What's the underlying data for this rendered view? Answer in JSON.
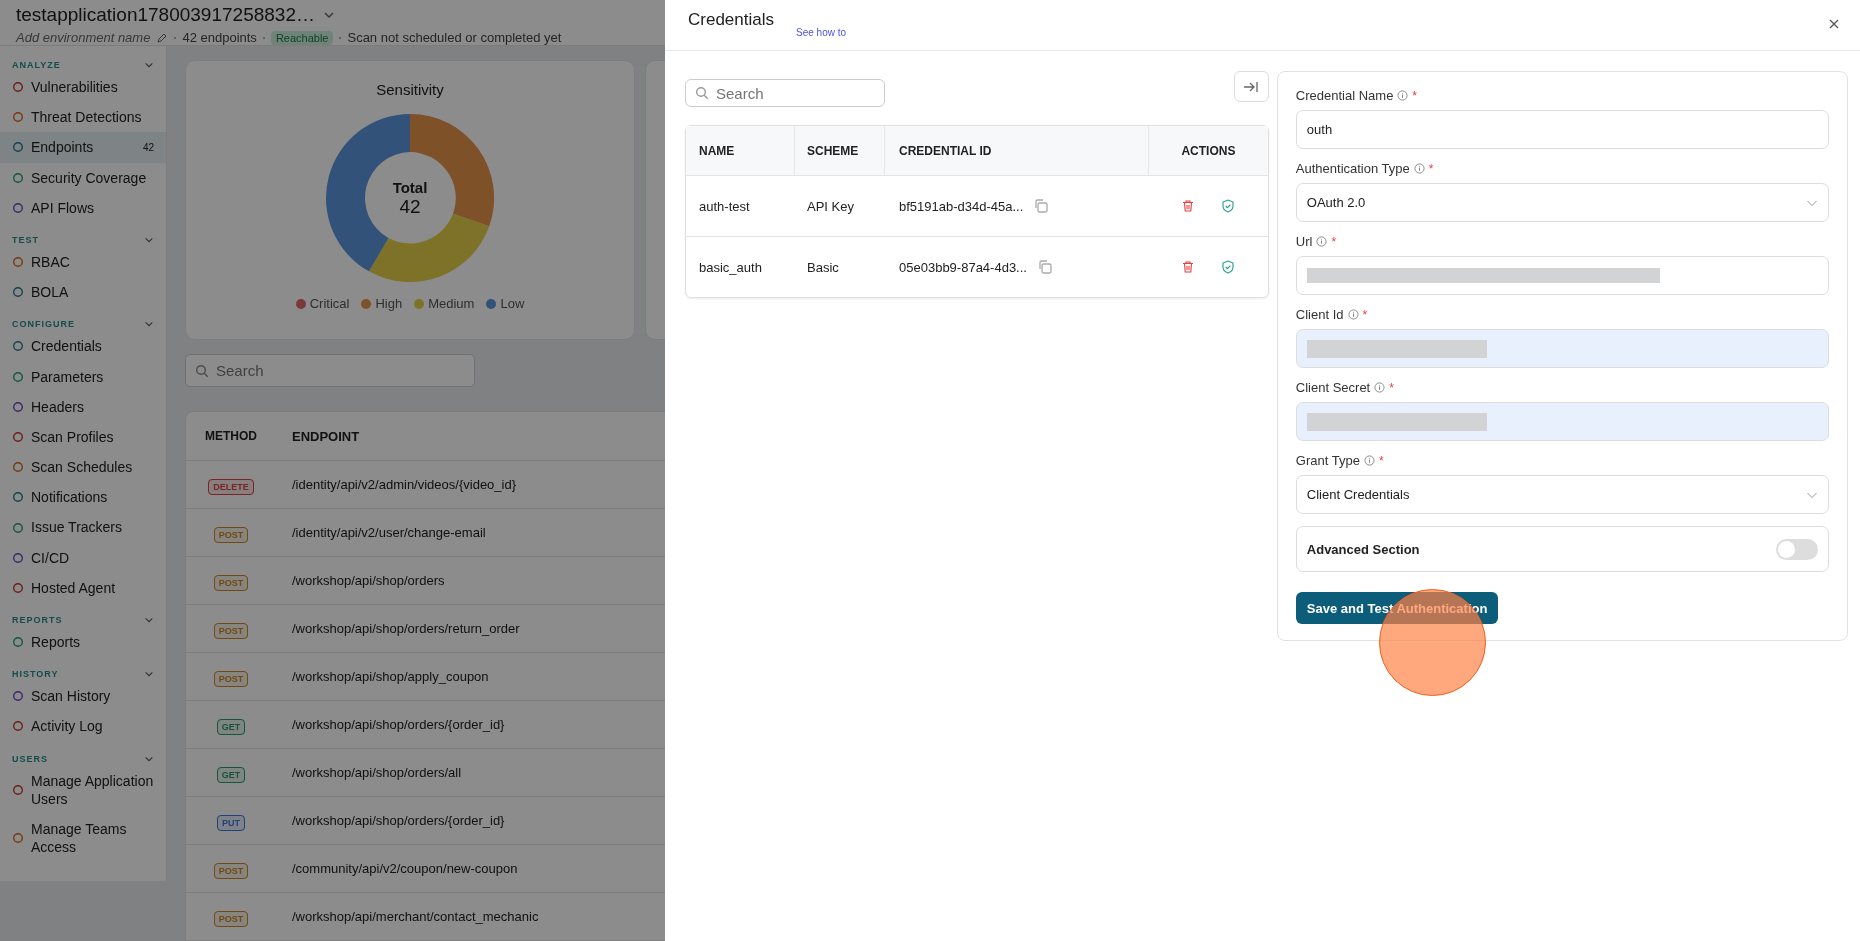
{
  "app": {
    "title": "testapplication178003917258832…",
    "environment_placeholder": "Add environment name",
    "endpoint_count": "42 endpoints",
    "status": "Reachable",
    "scan_status": "Scan not scheduled or completed yet"
  },
  "sidebar": {
    "sections": [
      {
        "title": "ANALYZE",
        "expanded": true,
        "items": [
          {
            "label": "Vulnerabilities",
            "selected": false
          },
          {
            "label": "Threat Detections",
            "selected": false
          },
          {
            "label": "Endpoints",
            "selected": true,
            "badge": "42"
          },
          {
            "label": "Security Coverage",
            "selected": false
          },
          {
            "label": "API Flows",
            "selected": false
          }
        ]
      },
      {
        "title": "TEST",
        "expanded": true,
        "items": [
          {
            "label": "RBAC",
            "selected": false
          },
          {
            "label": "BOLA",
            "selected": false
          }
        ]
      },
      {
        "title": "CONFIGURE",
        "expanded": true,
        "items": [
          {
            "label": "Credentials",
            "selected": false
          },
          {
            "label": "Parameters",
            "selected": false
          },
          {
            "label": "Headers",
            "selected": false
          },
          {
            "label": "Scan Profiles",
            "selected": false
          },
          {
            "label": "Scan Schedules",
            "selected": false
          },
          {
            "label": "Notifications",
            "selected": false
          },
          {
            "label": "Issue Trackers",
            "selected": false
          },
          {
            "label": "CI/CD",
            "selected": false
          },
          {
            "label": "Hosted Agent",
            "selected": false
          }
        ]
      },
      {
        "title": "REPORTS",
        "expanded": true,
        "items": [
          {
            "label": "Reports",
            "selected": false
          }
        ]
      },
      {
        "title": "HISTORY",
        "expanded": true,
        "items": [
          {
            "label": "Scan History",
            "selected": false
          },
          {
            "label": "Activity Log",
            "selected": false
          }
        ]
      },
      {
        "title": "USERS",
        "expanded": true,
        "items": [
          {
            "label": "Manage Application Users",
            "selected": false
          },
          {
            "label": "Manage Teams Access",
            "selected": false
          }
        ]
      }
    ]
  },
  "sensitivity_card": {
    "title": "Sensitivity",
    "total_label": "Total",
    "total": "42",
    "legend": [
      "Critical",
      "High",
      "Medium",
      "Low"
    ]
  },
  "endpoint_search": {
    "placeholder": "Search"
  },
  "endpoints_table": {
    "columns": [
      "METHOD",
      "ENDPOINT"
    ],
    "rows": [
      {
        "method": "DELETE",
        "kind": "delete",
        "path": "/identity/api/v2/admin/videos/{video_id}"
      },
      {
        "method": "POST",
        "kind": "post",
        "path": "/identity/api/v2/user/change-email"
      },
      {
        "method": "POST",
        "kind": "post",
        "path": "/workshop/api/shop/orders"
      },
      {
        "method": "POST",
        "kind": "post",
        "path": "/workshop/api/shop/orders/return_order"
      },
      {
        "method": "POST",
        "kind": "post",
        "path": "/workshop/api/shop/apply_coupon"
      },
      {
        "method": "GET",
        "kind": "get",
        "path": "/workshop/api/shop/orders/{order_id}"
      },
      {
        "method": "GET",
        "kind": "get",
        "path": "/workshop/api/shop/orders/all"
      },
      {
        "method": "PUT",
        "kind": "put",
        "path": "/workshop/api/shop/orders/{order_id}"
      },
      {
        "method": "POST",
        "kind": "post",
        "path": "/community/api/v2/coupon/new-coupon"
      },
      {
        "method": "POST",
        "kind": "post",
        "path": "/workshop/api/merchant/contact_mechanic"
      }
    ]
  },
  "drawer": {
    "title": "Credentials",
    "help_link": "See how to",
    "search": {
      "placeholder": "Search"
    },
    "table": {
      "columns": [
        "NAME",
        "SCHEME",
        "CREDENTIAL ID",
        "ACTIONS"
      ],
      "rows": [
        {
          "name": "auth-test",
          "scheme": "API Key",
          "credential_id": "bf5191ab-d34d-45a..."
        },
        {
          "name": "basic_auth",
          "scheme": "Basic",
          "credential_id": "05e03bb9-87a4-4d3..."
        }
      ]
    },
    "form": {
      "fields": [
        {
          "label": "Credential Name",
          "kind": "text",
          "required_mark": "*",
          "value": "outh"
        },
        {
          "label": "Authentication Type",
          "kind": "select",
          "required_mark": "*",
          "value": "OAuth 2.0"
        },
        {
          "label": "Url",
          "kind": "hidden",
          "required_mark": "*",
          "autofilled": false
        },
        {
          "label": "Client Id",
          "kind": "hidden",
          "required_mark": "*",
          "autofilled": true
        },
        {
          "label": "Client Secret",
          "kind": "hidden",
          "required_mark": "*",
          "autofilled": true
        },
        {
          "label": "Grant Type",
          "kind": "select",
          "required_mark": "*",
          "value": "Client Credentials"
        }
      ],
      "advanced": {
        "label": "Advanced Section",
        "on": false
      },
      "submit": "Save and Test Authentication"
    }
  }
}
